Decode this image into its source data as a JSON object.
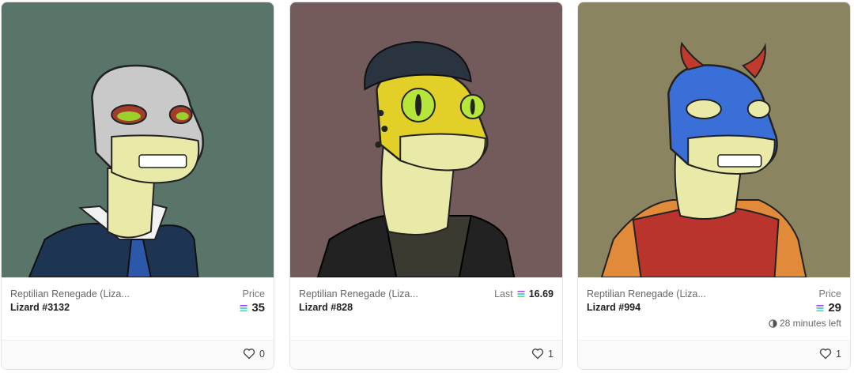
{
  "cards": [
    {
      "collection": "Reptilian Renegade (Liza...",
      "name": "Lizard #3132",
      "price_label": "Price",
      "price": "35",
      "likes": "0",
      "bg_color": "#597569",
      "skin_color": "#c8c8c8"
    },
    {
      "collection": "Reptilian Renegade (Liza...",
      "name": "Lizard #828",
      "last_label": "Last",
      "last_price": "16.69",
      "likes": "1",
      "bg_color": "#735a5b",
      "skin_color": "#e2cf28"
    },
    {
      "collection": "Reptilian Renegade (Liza...",
      "name": "Lizard #994",
      "price_label": "Price",
      "price": "29",
      "time_left": "28 minutes left",
      "likes": "1",
      "bg_color": "#8a8460",
      "skin_color": "#3a6fd8"
    }
  ],
  "icons": {
    "currency": "solana-icon",
    "like": "heart-icon",
    "timer": "clock-icon"
  }
}
